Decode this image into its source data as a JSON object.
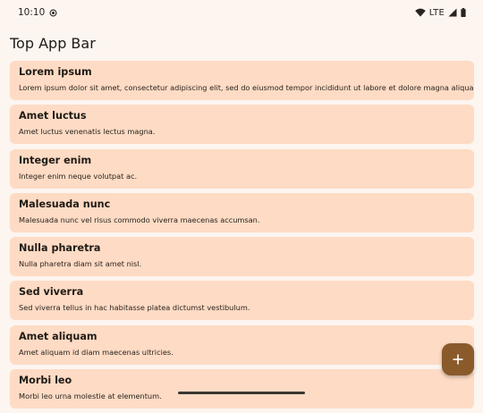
{
  "status_bar": {
    "time": "10:10",
    "network": "LTE",
    "icons": [
      "sync-icon",
      "wifi-icon",
      "signal-icon",
      "battery-icon"
    ]
  },
  "app_bar": {
    "title": "Top App Bar"
  },
  "list": {
    "items": [
      {
        "title": "Lorem ipsum",
        "body": "Lorem ipsum dolor sit amet, consectetur adipiscing elit, sed do eiusmod tempor incididunt ut labore et dolore magna aliqua."
      },
      {
        "title": "Amet luctus",
        "body": "Amet luctus venenatis lectus magna."
      },
      {
        "title": "Integer enim",
        "body": "Integer enim neque volutpat ac."
      },
      {
        "title": "Malesuada nunc",
        "body": "Malesuada nunc vel risus commodo viverra maecenas accumsan."
      },
      {
        "title": "Nulla pharetra",
        "body": "Nulla pharetra diam sit amet nisl."
      },
      {
        "title": "Sed viverra",
        "body": "Sed viverra tellus in hac habitasse platea dictumst vestibulum."
      },
      {
        "title": "Amet aliquam",
        "body": "Amet aliquam id diam maecenas ultricies."
      },
      {
        "title": "Morbi leo",
        "body": "Morbi leo urna molestie at elementum."
      }
    ]
  },
  "fab": {
    "icon": "plus-icon"
  },
  "colors": {
    "background": "#fcf5f0",
    "card": "#fedbc4",
    "fab": "#8a5a2b",
    "text": "#1f1b16"
  }
}
